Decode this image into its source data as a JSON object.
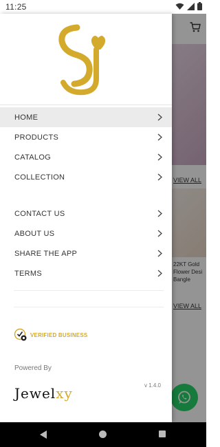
{
  "status_bar": {
    "time": "11:25"
  },
  "background": {
    "view_all_1": "VIEW ALL",
    "product_name": "22KT Gold Flower Desi Bangle",
    "view_all_2": "VIEW ALL"
  },
  "drawer": {
    "menu_primary": [
      {
        "label": "HOME",
        "active": true
      },
      {
        "label": "PRODUCTS"
      },
      {
        "label": "CATALOG"
      },
      {
        "label": "COLLECTION"
      }
    ],
    "menu_secondary": [
      {
        "label": "CONTACT US"
      },
      {
        "label": "ABOUT US"
      },
      {
        "label": "SHARE THE APP"
      },
      {
        "label": "TERMS"
      }
    ],
    "verified_label": "VERIFIED BUSINESS",
    "powered_by": "Powered By",
    "brand_name_main": "Jewel",
    "brand_name_accent": "xy",
    "version": "v 1.4.0"
  },
  "colors": {
    "gold": "#d4aa2c",
    "whatsapp": "#25d366",
    "active_row": "#ebebeb"
  },
  "icons": [
    "wifi-icon",
    "signal-icon",
    "battery-icon",
    "cart-icon",
    "chevron-right-icon",
    "verified-check-icon",
    "whatsapp-icon",
    "back-icon",
    "home-icon",
    "recents-icon"
  ]
}
